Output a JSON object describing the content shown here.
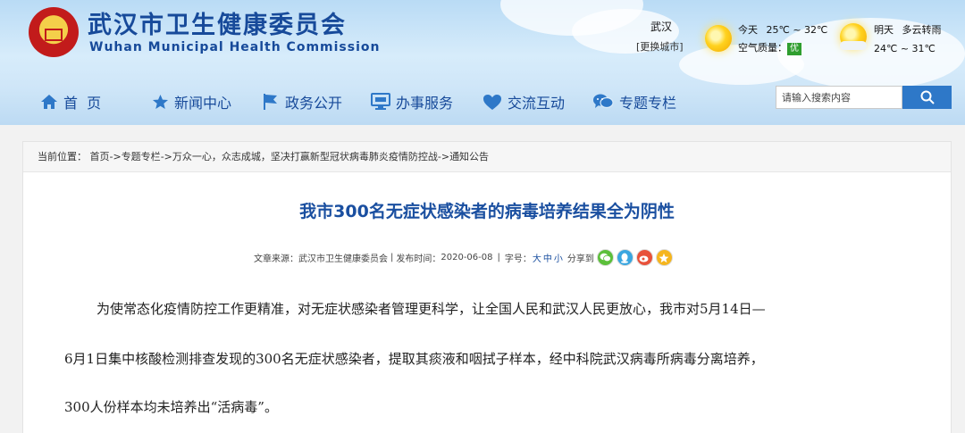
{
  "header": {
    "title": "武汉市卫生健康委员会",
    "subtitle": "Wuhan Municipal Health Commission"
  },
  "weather": {
    "city": "武汉",
    "change_city": "[更换城市]",
    "today_label": "今天",
    "today_temp": "25℃ ~ 32℃",
    "air_label": "空气质量：",
    "air_value": "优",
    "tomorrow_label": "明天",
    "tomorrow_desc": "多云转雨",
    "tomorrow_temp": "24℃ ~ 31℃"
  },
  "nav": {
    "items": [
      {
        "label": "首  页",
        "icon": "home-icon"
      },
      {
        "label": "新闻中心",
        "icon": "star-icon"
      },
      {
        "label": "政务公开",
        "icon": "flag-icon"
      },
      {
        "label": "办事服务",
        "icon": "monitor-icon"
      },
      {
        "label": "交流互动",
        "icon": "heart-icon"
      },
      {
        "label": "专题专栏",
        "icon": "chat-icon"
      }
    ]
  },
  "search": {
    "placeholder": "请输入搜索内容",
    "icon": "search-icon"
  },
  "breadcrumb": {
    "prefix": "当前位置：",
    "items": [
      "首页",
      "专题专栏",
      "万众一心，众志成城，坚决打赢新型冠状病毒肺炎疫情防控战",
      "通知公告"
    ],
    "separator": "->"
  },
  "article": {
    "title": "我市300名无症状感染者的病毒培养结果全为阴性",
    "source_label": "文章来源：",
    "source": "武汉市卫生健康委员会",
    "date_label": "发布时间：",
    "date": "2020-06-08",
    "fontsize_label": "字号：",
    "fontsize_options": [
      "大",
      "中",
      "小"
    ],
    "share_label": "分享到",
    "share_icons": [
      "wechat-icon",
      "qq-icon",
      "weibo-icon",
      "qzone-icon"
    ],
    "paragraph_lines": [
      "为使常态化疫情防控工作更精准，对无症状感染者管理更科学，让全国人民和武汉人民更放心，我市对5月14日—",
      "6月1日集中核酸检测排查发现的300名无症状感染者，提取其痰液和咽拭子样本，经中科院武汉病毒所病毒分离培养，",
      "300人份样本均未培养出“活病毒”。"
    ]
  },
  "colors": {
    "brand_blue": "#174a9a",
    "title_blue": "#1a4fa0",
    "search_button": "#2e78c8",
    "air_good": "#2f9e2f"
  }
}
